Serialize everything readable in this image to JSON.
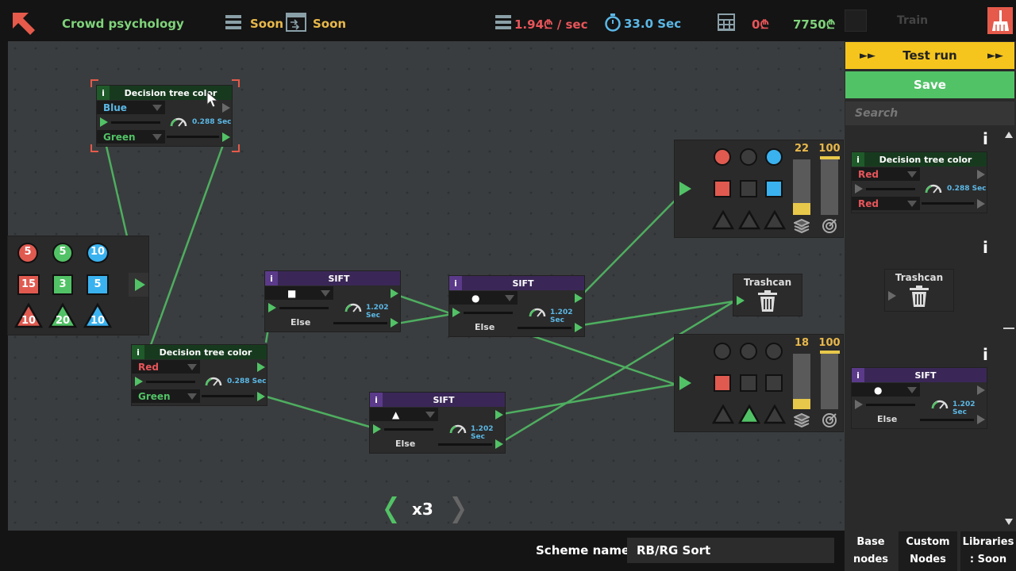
{
  "header": {
    "title": "Crowd psychology",
    "queue_label": "Soon",
    "transfer_label": "Soon",
    "rate": "1.94₾ / sec",
    "timer": "33.0 Sec",
    "money": "0₾",
    "goal": "7750₾",
    "train_label": "Train",
    "colors": {
      "title": "#7fd37a",
      "rate": "#e8555a",
      "timer": "#5bb8e6",
      "money": "#e8555a",
      "goal": "#7fd37a"
    }
  },
  "inventory": {
    "rows": [
      [
        {
          "shape": "circle",
          "color": "red",
          "count": "5"
        },
        {
          "shape": "circle",
          "color": "green",
          "count": "5"
        },
        {
          "shape": "circle",
          "color": "blue",
          "count": "10"
        }
      ],
      [
        {
          "shape": "square",
          "color": "red",
          "count": "15"
        },
        {
          "shape": "square",
          "color": "green",
          "count": "3"
        },
        {
          "shape": "square",
          "color": "blue",
          "count": "5"
        }
      ],
      [
        {
          "shape": "triangle",
          "color": "red",
          "count": "10"
        },
        {
          "shape": "triangle",
          "color": "green",
          "count": "20"
        },
        {
          "shape": "triangle",
          "color": "blue",
          "count": "10"
        }
      ]
    ]
  },
  "nodes": {
    "dt1": {
      "title": "Decision tree color",
      "info": "i",
      "top_value": "Blue",
      "bottom_value": "Green",
      "speed": "0.288 Sec"
    },
    "dt2": {
      "title": "Decision tree color",
      "info": "i",
      "top_value": "Red",
      "bottom_value": "Green",
      "speed": "0.288 Sec"
    },
    "sift1": {
      "title": "SIFT",
      "info": "i",
      "filter": "■",
      "else_label": "Else",
      "speed": "1.202 Sec"
    },
    "sift2": {
      "title": "SIFT",
      "info": "i",
      "filter": "●",
      "else_label": "Else",
      "speed": "1.202 Sec"
    },
    "sift3": {
      "title": "SIFT",
      "info": "i",
      "filter": "▲",
      "else_label": "Else",
      "speed": "1.202 Sec"
    },
    "trash": {
      "title": "Trashcan"
    },
    "out1": {
      "count": "22",
      "target": "100",
      "progress": 0.22
    },
    "out2": {
      "count": "18",
      "target": "100",
      "progress": 0.18
    }
  },
  "speed": {
    "multiplier": "x3"
  },
  "scheme": {
    "label": "Scheme name :",
    "value": "RB/RG Sort"
  },
  "side": {
    "test_run": "Test run",
    "save": "Save",
    "search_placeholder": "Search",
    "info": "i",
    "dt": {
      "title": "Decision tree color",
      "info": "i",
      "top_value": "Red",
      "bottom_value": "Red",
      "speed": "0.288 Sec"
    },
    "trash": {
      "title": "Trashcan"
    },
    "sift": {
      "title": "SIFT",
      "info": "i",
      "filter": "●",
      "else_label": "Else",
      "speed": "1.202 Sec"
    },
    "tabs": [
      {
        "line1": "Base",
        "line2": "nodes"
      },
      {
        "line1": "Custom",
        "line2": "Nodes"
      },
      {
        "line1": "Libraries",
        "line2": ": Soon"
      }
    ]
  }
}
